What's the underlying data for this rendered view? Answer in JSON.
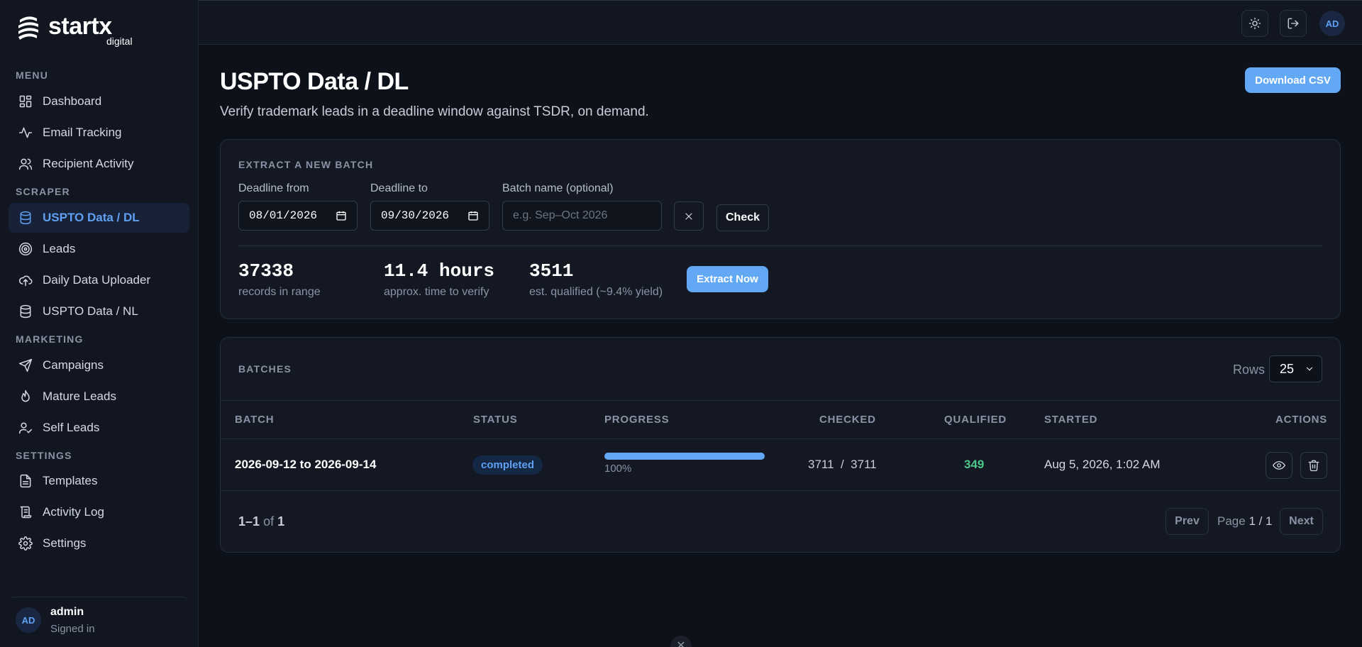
{
  "brand": {
    "name": "startx",
    "sub": "digital"
  },
  "sidebar": {
    "sections": {
      "menu": "MENU",
      "scraper": "SCRAPER",
      "marketing": "MARKETING",
      "settings": "SETTINGS"
    },
    "items": [
      {
        "label": "Dashboard",
        "icon": "dashboard-icon"
      },
      {
        "label": "Email Tracking",
        "icon": "activity-icon"
      },
      {
        "label": "Recipient Activity",
        "icon": "users-icon"
      },
      {
        "label": "USPTO Data / DL",
        "icon": "database-icon",
        "active": true
      },
      {
        "label": "Leads",
        "icon": "target-icon"
      },
      {
        "label": "Daily Data Uploader",
        "icon": "cloud-upload-icon"
      },
      {
        "label": "USPTO Data / NL",
        "icon": "database-icon"
      },
      {
        "label": "Campaigns",
        "icon": "send-icon"
      },
      {
        "label": "Mature Leads",
        "icon": "flame-icon"
      },
      {
        "label": "Self Leads",
        "icon": "user-check-icon"
      },
      {
        "label": "Templates",
        "icon": "file-text-icon"
      },
      {
        "label": "Activity Log",
        "icon": "scroll-icon"
      },
      {
        "label": "Settings",
        "icon": "gear-icon"
      }
    ],
    "user": {
      "initials": "AD",
      "name": "admin",
      "status": "Signed in"
    }
  },
  "topbar": {
    "avatar_initials": "AD"
  },
  "page": {
    "title": "USPTO Data / DL",
    "subtitle": "Verify trademark leads in a deadline window against TSDR, on demand.",
    "download_label": "Download CSV"
  },
  "extract": {
    "heading": "EXTRACT A NEW BATCH",
    "deadline_from_label": "Deadline from",
    "deadline_from_value": "08/01/2026",
    "deadline_to_label": "Deadline to",
    "deadline_to_value": "09/30/2026",
    "batch_name_label": "Batch name (optional)",
    "batch_name_placeholder": "e.g. Sep–Oct 2026",
    "check_label": "Check",
    "stats": [
      {
        "value": "37338",
        "label": "records in range"
      },
      {
        "value": "11.4 hours",
        "label": "approx. time to verify"
      },
      {
        "value": "3511",
        "label": "est. qualified (~9.4% yield)"
      }
    ],
    "extract_label": "Extract Now"
  },
  "batches": {
    "heading": "BATCHES",
    "rows_label": "Rows",
    "rows_value": "25",
    "columns": [
      "BATCH",
      "STATUS",
      "PROGRESS",
      "CHECKED",
      "QUALIFIED",
      "STARTED",
      "ACTIONS"
    ],
    "rows": [
      {
        "batch": "2026-09-12 to 2026-09-14",
        "status": "completed",
        "progress": 100,
        "progress_text": "100%",
        "checked": "3711  /  3711",
        "qualified": "349",
        "started": "Aug 5, 2026, 1:02 AM"
      }
    ],
    "pager": {
      "range": "1–1",
      "of": "of",
      "total": "1",
      "prev": "Prev",
      "next": "Next",
      "page_prefix": "Page",
      "page_current": "1 / 1"
    }
  },
  "colors": {
    "accent": "#62a8f5",
    "qualified": "#4cc98a",
    "bg": "#0d111a",
    "sidebar": "#111620"
  }
}
